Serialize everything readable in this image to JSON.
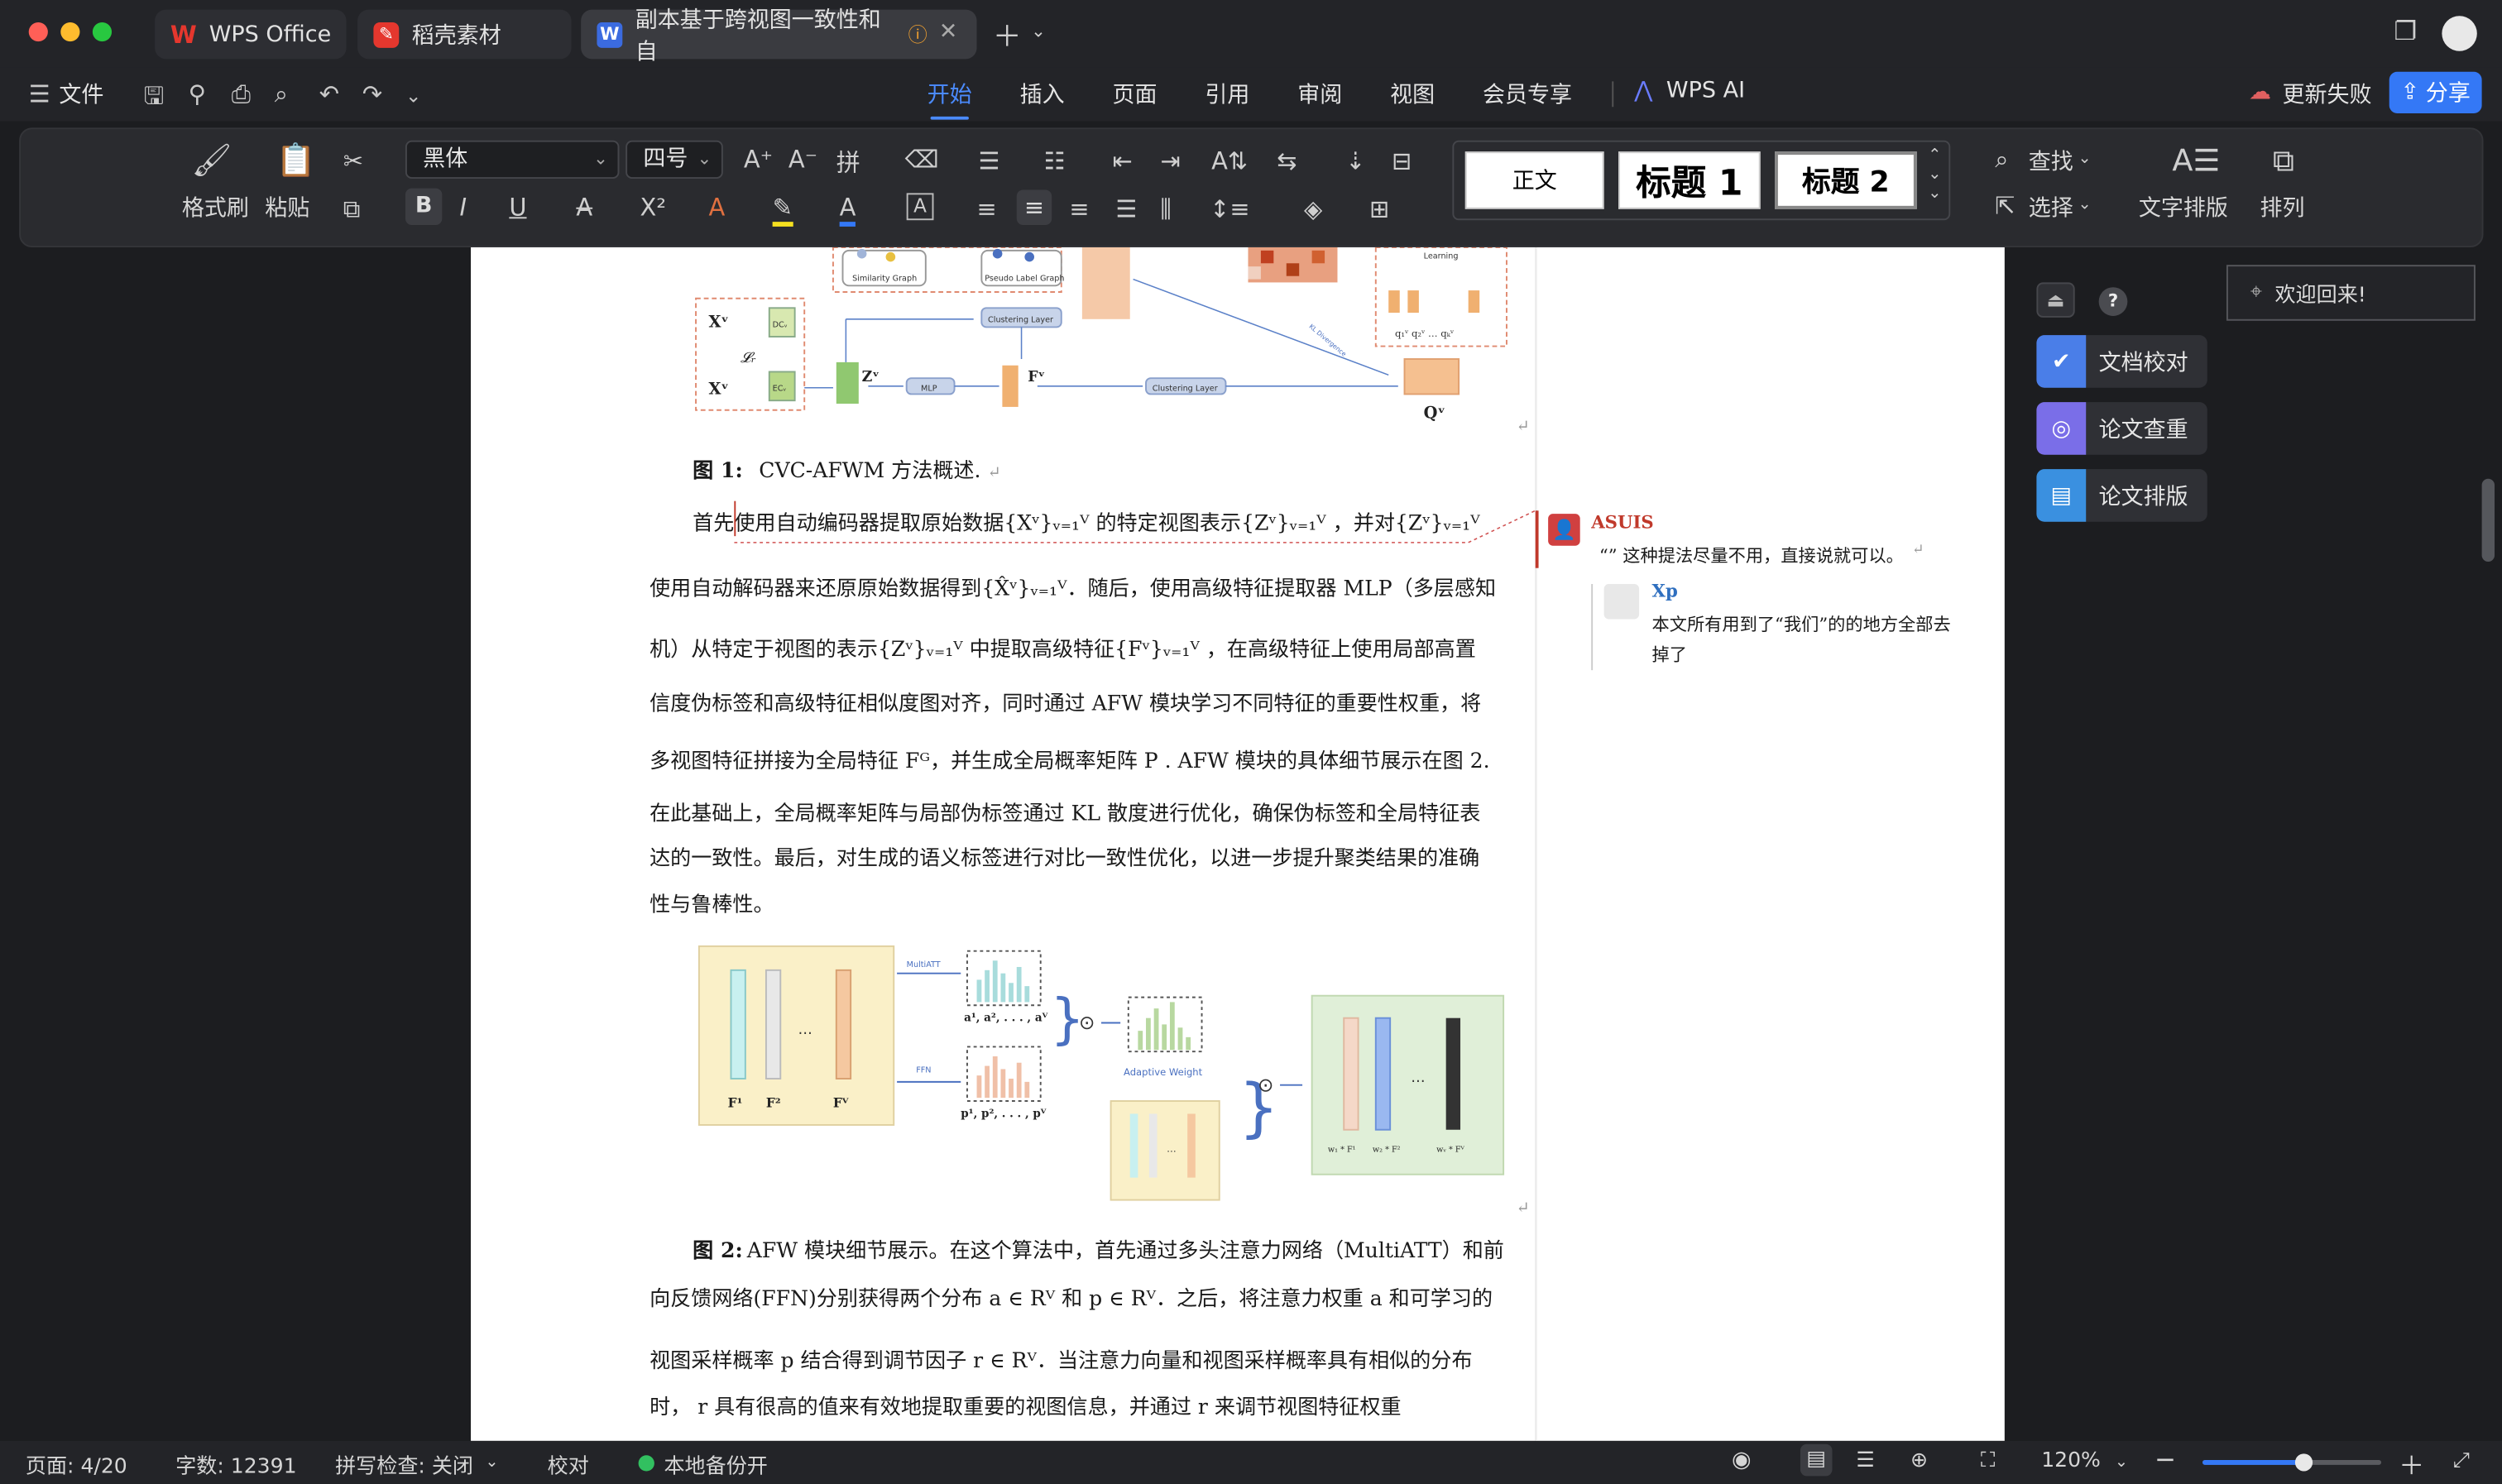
{
  "tabs": [
    {
      "label": "WPS Office",
      "icon": "wps-logo-icon"
    },
    {
      "label": "稻壳素材",
      "icon": "docer-icon"
    },
    {
      "label": "副本基于跨视图一致性和自",
      "icon": "word-doc-icon"
    }
  ],
  "menu": {
    "file": "文件",
    "items": [
      "开始",
      "插入",
      "页面",
      "引用",
      "审阅",
      "视图",
      "会员专享"
    ],
    "wps_ai": "WPS AI",
    "update_failed": "更新失败",
    "share": "分享"
  },
  "ribbon": {
    "format_painter": "格式刷",
    "paste": "粘贴",
    "font_name": "黑体",
    "font_size": "四号",
    "styles": [
      "正文",
      "标题 1",
      "标题 2"
    ],
    "find": "查找",
    "select": "选择",
    "text_layout": "文字排版",
    "arrange": "排列"
  },
  "document": {
    "fig1_caption_label": "图 1:",
    "fig1_caption_text": "CVC-AFWM 方法概述.",
    "para1_lines": [
      "首先使用自动编码器提取原始数据{Xᵛ}ᵥ₌₁ⱽ 的特定视图表示{Zᵛ}ᵥ₌₁ⱽ ，并对{Zᵛ}ᵥ₌₁ⱽ",
      "使用自动解码器来还原原始数据得到{X̂ᵛ}ᵥ₌₁ⱽ．随后，使用高级特征提取器 MLP（多层感知",
      "机）从特定于视图的表示{Zᵛ}ᵥ₌₁ⱽ 中提取高级特征{Fᵛ}ᵥ₌₁ⱽ ，在高级特征上使用局部高置",
      "信度伪标签和高级特征相似度图对齐，同时通过 AFW 模块学习不同特征的重要性权重，将",
      "多视图特征拼接为全局特征 Fᴳ，并生成全局概率矩阵 P . AFW 模块的具体细节展示在图 2.",
      "在此基础上，全局概率矩阵与局部伪标签通过 KL 散度进行优化，确保伪标签和全局特征表",
      "达的一致性。最后，对生成的语义标签进行对比一致性优化，以进一步提升聚类结果的准确",
      "性与鲁棒性。"
    ],
    "fig2_caption_label": "图 2:",
    "para2_lines": [
      "AFW 模块细节展示。在这个算法中，首先通过多头注意力网络（MultiATT）和前",
      "向反馈网络(FFN)分别获得两个分布 a ∈ Rⱽ 和 p ∈ Rⱽ．之后，将注意力权重 a 和可学习的",
      "视图采样概率 p 结合得到调节因子 r ∈ Rⱽ．当注意力向量和视图采样概率具有相似的分布",
      "时， r 具有很高的值来有效地提取重要的视图信息，并通过 r 来调节视图特征权重"
    ],
    "fig1_labels": {
      "similarity_graph": "Similarity Graph",
      "pseudo_label_graph": "Pseudo Label Graph",
      "clustering_layer": "Clustering Layer",
      "mlp": "MLP",
      "clustering_layer2": "Clustering Layer",
      "learning": "Learning",
      "xv1": "Xᵛ",
      "xv2": "Xᵛ",
      "lr": "𝓛ᵣ",
      "zv": "Zᵛ",
      "fv": "Fᵛ",
      "qv": "Qᵛ",
      "dcv": "DCᵥ",
      "ecv": "ECᵥ",
      "q_labels": "q₁ᵛ q₂ᵛ … qₖᵛ",
      "kl": "KL Divergence"
    },
    "fig2_labels": {
      "multiatt": "MultiATT",
      "ffn": "FFN",
      "a_seq": "a¹, a², . . . , aⱽ",
      "p_seq": "p¹, p², . . . , pⱽ",
      "adaptive_weight": "Adaptive Weight",
      "f_labels": [
        "F¹",
        "F²",
        "…",
        "Fⱽ"
      ],
      "w_labels": [
        "w₁ * F¹",
        "w₂ * F²",
        "…",
        "wᵥ * Fⱽ"
      ],
      "dots": "…",
      "otimes": "⊙"
    }
  },
  "comments": [
    {
      "author": "ASUIS",
      "text": "“” 这种提法尽量不用，直接说就可以。"
    },
    {
      "author": "Xp",
      "text_line1": "本文所有用到了“我们”的的地方全部去",
      "text_line2": "掉了"
    }
  ],
  "sidebar": {
    "welcome": "欢迎回来!",
    "buttons": [
      "文档校对",
      "论文查重",
      "论文排版"
    ],
    "help": "?"
  },
  "status": {
    "page": "页面: 4/20",
    "words": "字数: 12391",
    "spell": "拼写检查: 关闭",
    "proof": "校对",
    "backup": "本地备份开",
    "zoom": "120%",
    "zoom_level": 0.56
  },
  "colors": {
    "accent": "#4b8bff",
    "wps_red": "#e5372e",
    "comment_red": "#c0392b",
    "comment_blue": "#2f6fbf"
  }
}
